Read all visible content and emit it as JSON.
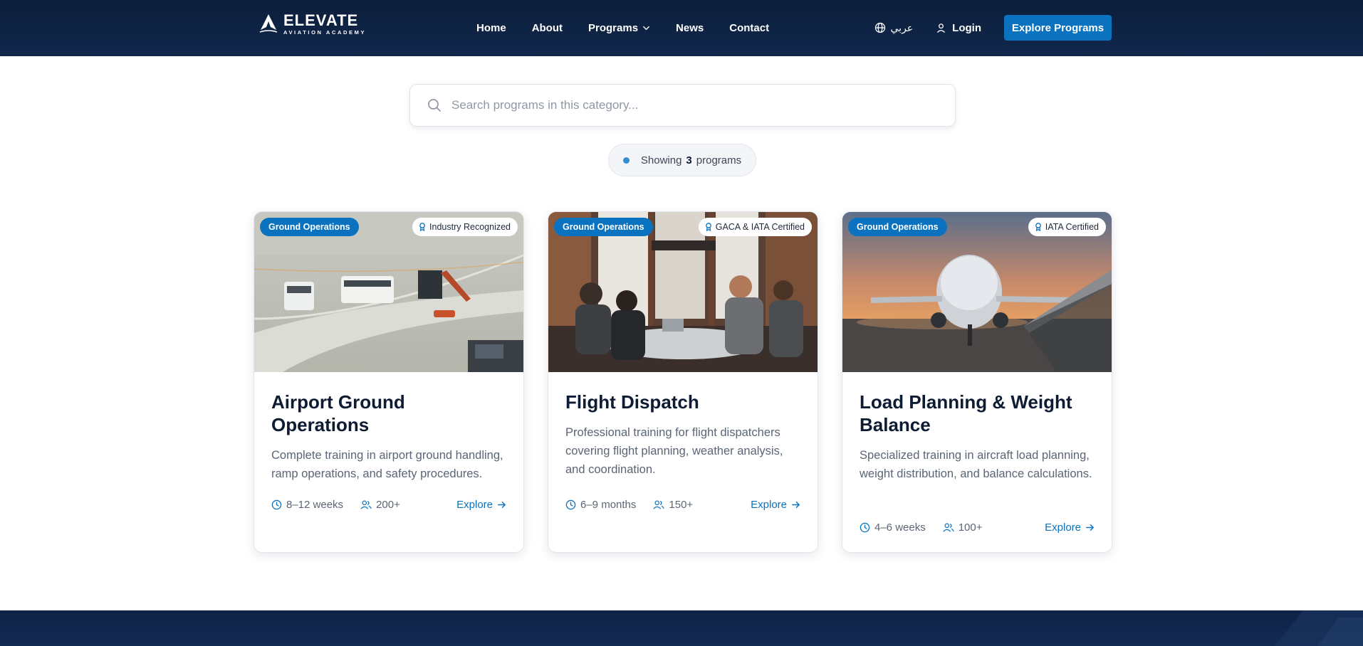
{
  "header": {
    "logo_title": "ELEVATE",
    "logo_subtitle": "AVIATION ACADEMY",
    "nav": [
      {
        "label": "Home"
      },
      {
        "label": "About"
      },
      {
        "label": "Programs"
      },
      {
        "label": "News"
      },
      {
        "label": "Contact"
      }
    ],
    "language_label": "عربي",
    "login_label": "Login",
    "cta_label": "Explore Programs"
  },
  "search": {
    "placeholder": "Search programs in this category..."
  },
  "results": {
    "prefix": "Showing",
    "count": "3",
    "suffix": "programs"
  },
  "colors": {
    "header_bg": "#0c1d3a",
    "accent": "#0a72bf",
    "title_text": "#0d1b33",
    "body_text": "#5b6575"
  },
  "programs": [
    {
      "category": "Ground Operations",
      "certification": "Industry Recognized",
      "title": "Airport Ground Operations",
      "description": "Complete training in airport ground handling, ramp operations, and safety procedures.",
      "duration": "8–12 weeks",
      "students": "200+",
      "link_label": "Explore"
    },
    {
      "category": "Ground Operations",
      "certification": "GACA & IATA Certified",
      "title": "Flight Dispatch",
      "description": "Professional training for flight dispatchers covering flight planning, weather analysis, and coordination.",
      "duration": "6–9 months",
      "students": "150+",
      "link_label": "Explore"
    },
    {
      "category": "Ground Operations",
      "certification": "IATA Certified",
      "title": "Load Planning & Weight Balance",
      "description": "Specialized training in aircraft load planning, weight distribution, and balance calculations.",
      "duration": "4–6 weeks",
      "students": "100+",
      "link_label": "Explore"
    }
  ]
}
